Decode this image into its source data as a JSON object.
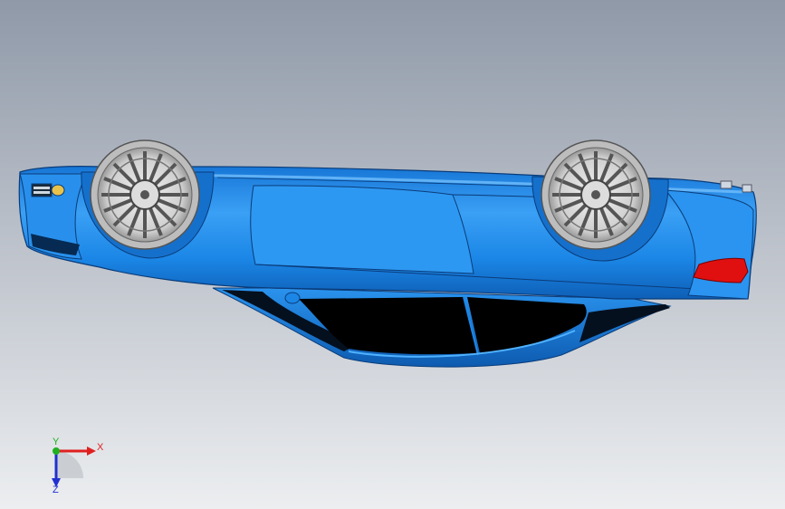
{
  "viewport": {
    "background_top": "#8f99a8",
    "background_bottom": "#e9ebee"
  },
  "model": {
    "name": "car-body-upside-down",
    "body_color": "#1b86e6",
    "body_highlight": "#4fb2ff",
    "body_dark": "#0b4f9c",
    "window_color": "#000000",
    "taillight_color": "#e01010",
    "wheel_color": "#d9d9d9"
  },
  "triad": {
    "x_label": "X",
    "y_label": "Y",
    "z_label": "Z",
    "x_color": "#e02020",
    "y_color": "#20b020",
    "z_color": "#2030d0"
  }
}
